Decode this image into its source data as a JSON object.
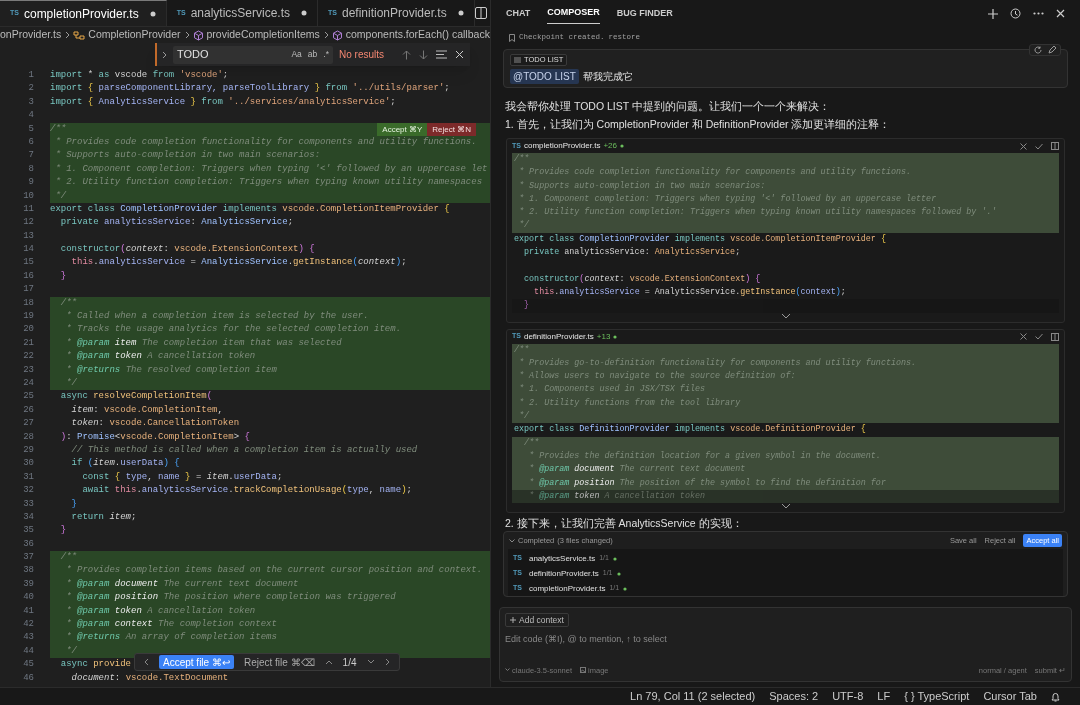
{
  "editor": {
    "tabs": [
      {
        "lang": "TS",
        "label": "completionProvider.ts",
        "selected": true,
        "modified": true
      },
      {
        "lang": "TS",
        "label": "analyticsService.ts",
        "selected": false,
        "modified": true
      },
      {
        "lang": "TS",
        "label": "definitionProvider.ts",
        "selected": false,
        "modified": true
      }
    ],
    "breadcrumbs": [
      {
        "kind": "file",
        "label": "onProvider.ts"
      },
      {
        "kind": "class",
        "label": "CompletionProvider"
      },
      {
        "kind": "method",
        "label": "provideCompletionItems"
      },
      {
        "kind": "method",
        "label": "components.forEach() callback"
      }
    ],
    "find": {
      "value": "TODO",
      "options": [
        "Aa",
        "ab",
        ".*"
      ],
      "result": "No results"
    },
    "lines": [
      {
        "n": "1",
        "diff": false,
        "tokens": [
          {
            "kind": "k",
            "text": "import"
          },
          {
            "kind": "p",
            "text": " * "
          },
          {
            "kind": "k",
            "text": "as"
          },
          {
            "kind": "p",
            "text": " vscode "
          },
          {
            "kind": "k",
            "text": "from"
          },
          {
            "kind": "s",
            "text": " 'vscode'"
          },
          {
            "kind": "p",
            "text": ";"
          }
        ]
      },
      {
        "n": "2",
        "diff": false,
        "tokens": [
          {
            "kind": "k",
            "text": "import"
          },
          {
            "kind": "b1",
            "text": " {"
          },
          {
            "kind": "v",
            "text": " parseComponentLibrary, parseToolLibrary "
          },
          {
            "kind": "b1",
            "text": "}"
          },
          {
            "kind": "k",
            "text": " from"
          },
          {
            "kind": "s",
            "text": " '../utils/parser'"
          },
          {
            "kind": "p",
            "text": ";"
          }
        ]
      },
      {
        "n": "3",
        "diff": false,
        "tokens": [
          {
            "kind": "k",
            "text": "import"
          },
          {
            "kind": "b1",
            "text": " {"
          },
          {
            "kind": "v",
            "text": " AnalyticsService "
          },
          {
            "kind": "b1",
            "text": "}"
          },
          {
            "kind": "k",
            "text": " from"
          },
          {
            "kind": "s",
            "text": " '../services/analyticsService'"
          },
          {
            "kind": "p",
            "text": ";"
          }
        ]
      },
      {
        "n": "4",
        "diff": false
      },
      {
        "n": "5",
        "diff": true,
        "tokens": [
          {
            "kind": "cm",
            "text": "/**"
          }
        ],
        "actions": [
          {
            "kind": "accept",
            "label": "Accept ⌘Y"
          },
          {
            "kind": "reject",
            "label": "Reject ⌘N"
          }
        ]
      },
      {
        "n": "6",
        "diff": true,
        "tokens": [
          {
            "kind": "cm",
            "text": " * Provides code completion functionality for components and utility functions."
          }
        ]
      },
      {
        "n": "7",
        "diff": true,
        "tokens": [
          {
            "kind": "cm",
            "text": " * Supports auto-completion in two main scenarios:"
          }
        ]
      },
      {
        "n": "8",
        "diff": true,
        "tokens": [
          {
            "kind": "cm",
            "text": " * 1. Component completion: Triggers when typing '<' followed by an uppercase let"
          }
        ]
      },
      {
        "n": "9",
        "diff": true,
        "tokens": [
          {
            "kind": "cm",
            "text": " * 2. Utility function completion: Triggers when typing known utility namespaces"
          }
        ]
      },
      {
        "n": "10",
        "diff": true,
        "tokens": [
          {
            "kind": "cm",
            "text": " */"
          }
        ]
      },
      {
        "n": "11",
        "diff": false,
        "tokens": [
          {
            "kind": "k",
            "text": "export class"
          },
          {
            "kind": "c",
            "text": " CompletionProvider"
          },
          {
            "kind": "k",
            "text": " implements"
          },
          {
            "kind": "ty",
            "text": " vscode.CompletionItemProvider"
          },
          {
            "kind": "b1",
            "text": " {"
          }
        ]
      },
      {
        "n": "12",
        "diff": false,
        "tokens": [
          {
            "kind": "k",
            "text": "  private"
          },
          {
            "kind": "v",
            "text": " analyticsService"
          },
          {
            "kind": "p",
            "text": ": "
          },
          {
            "kind": "c",
            "text": "AnalyticsService"
          },
          {
            "kind": "p",
            "text": ";"
          }
        ]
      },
      {
        "n": "13",
        "diff": false
      },
      {
        "n": "14",
        "diff": false,
        "tokens": [
          {
            "kind": "k",
            "text": "  constructor"
          },
          {
            "kind": "b2",
            "text": "("
          },
          {
            "kind": "it",
            "text": "context"
          },
          {
            "kind": "p",
            "text": ": "
          },
          {
            "kind": "ty",
            "text": "vscode.ExtensionContext"
          },
          {
            "kind": "b2",
            "text": ")"
          },
          {
            "kind": "b2",
            "text": " {"
          }
        ]
      },
      {
        "n": "15",
        "diff": false,
        "tokens": [
          {
            "kind": "th",
            "text": "    this"
          },
          {
            "kind": "p",
            "text": "."
          },
          {
            "kind": "v",
            "text": "analyticsService"
          },
          {
            "kind": "p",
            "text": " = "
          },
          {
            "kind": "c",
            "text": "AnalyticsService"
          },
          {
            "kind": "p",
            "text": "."
          },
          {
            "kind": "f",
            "text": "getInstance"
          },
          {
            "kind": "b3",
            "text": "("
          },
          {
            "kind": "it",
            "text": "context"
          },
          {
            "kind": "b3",
            "text": ")"
          },
          {
            "kind": "p",
            "text": ";"
          }
        ]
      },
      {
        "n": "16",
        "diff": false,
        "tokens": [
          {
            "kind": "b2",
            "text": "  }"
          }
        ]
      },
      {
        "n": "17",
        "diff": false
      },
      {
        "n": "18",
        "diff": true,
        "tokens": [
          {
            "kind": "cm",
            "text": "  /**"
          }
        ]
      },
      {
        "n": "19",
        "diff": true,
        "tokens": [
          {
            "kind": "cm",
            "text": "   * Called when a completion item is selected by the user."
          }
        ]
      },
      {
        "n": "20",
        "diff": true,
        "tokens": [
          {
            "kind": "cm",
            "text": "   * Tracks the usage analytics for the selected completion item."
          }
        ]
      },
      {
        "n": "21",
        "diff": true,
        "tokens": [
          {
            "kind": "cm",
            "text": "   * "
          },
          {
            "kind": "tg",
            "text": "@param"
          },
          {
            "kind": "pa",
            "text": " item"
          },
          {
            "kind": "cm",
            "text": " The completion item that was selected"
          }
        ]
      },
      {
        "n": "22",
        "diff": true,
        "tokens": [
          {
            "kind": "cm",
            "text": "   * "
          },
          {
            "kind": "tg",
            "text": "@param"
          },
          {
            "kind": "pa",
            "text": " token"
          },
          {
            "kind": "cm",
            "text": " A cancellation token"
          }
        ]
      },
      {
        "n": "23",
        "diff": true,
        "tokens": [
          {
            "kind": "cm",
            "text": "   * "
          },
          {
            "kind": "tg",
            "text": "@returns"
          },
          {
            "kind": "cm",
            "text": " The resolved completion item"
          }
        ]
      },
      {
        "n": "24",
        "diff": true,
        "tokens": [
          {
            "kind": "cm",
            "text": "   */"
          }
        ]
      },
      {
        "n": "25",
        "diff": false,
        "tokens": [
          {
            "kind": "k",
            "text": "  async"
          },
          {
            "kind": "f",
            "text": " resolveCompletionItem"
          },
          {
            "kind": "b2",
            "text": "("
          }
        ]
      },
      {
        "n": "26",
        "diff": false,
        "tokens": [
          {
            "kind": "it",
            "text": "    item"
          },
          {
            "kind": "p",
            "text": ": "
          },
          {
            "kind": "ty",
            "text": "vscode.CompletionItem"
          },
          {
            "kind": "p",
            "text": ","
          }
        ]
      },
      {
        "n": "27",
        "diff": false,
        "tokens": [
          {
            "kind": "it",
            "text": "    token"
          },
          {
            "kind": "p",
            "text": ": "
          },
          {
            "kind": "ty",
            "text": "vscode.CancellationToken"
          }
        ]
      },
      {
        "n": "28",
        "diff": false,
        "tokens": [
          {
            "kind": "b2",
            "text": "  )"
          },
          {
            "kind": "p",
            "text": ": "
          },
          {
            "kind": "c",
            "text": "Promise"
          },
          {
            "kind": "p",
            "text": "<"
          },
          {
            "kind": "ty",
            "text": "vscode.CompletionItem"
          },
          {
            "kind": "p",
            "text": ">"
          },
          {
            "kind": "b2",
            "text": " {"
          }
        ]
      },
      {
        "n": "29",
        "diff": false,
        "tokens": [
          {
            "kind": "cm",
            "text": "    // This method is called when a completion item is actually used"
          }
        ]
      },
      {
        "n": "30",
        "diff": false,
        "tokens": [
          {
            "kind": "k",
            "text": "    if"
          },
          {
            "kind": "b3",
            "text": " ("
          },
          {
            "kind": "it",
            "text": "item"
          },
          {
            "kind": "p",
            "text": "."
          },
          {
            "kind": "v",
            "text": "userData"
          },
          {
            "kind": "b3",
            "text": ")"
          },
          {
            "kind": "b3",
            "text": " {"
          }
        ]
      },
      {
        "n": "31",
        "diff": false,
        "tokens": [
          {
            "kind": "k",
            "text": "      const"
          },
          {
            "kind": "b1",
            "text": " {"
          },
          {
            "kind": "v",
            "text": " type"
          },
          {
            "kind": "p",
            "text": ", "
          },
          {
            "kind": "v",
            "text": "name "
          },
          {
            "kind": "b1",
            "text": "}"
          },
          {
            "kind": "p",
            "text": " = "
          },
          {
            "kind": "it",
            "text": "item"
          },
          {
            "kind": "p",
            "text": "."
          },
          {
            "kind": "v",
            "text": "userData"
          },
          {
            "kind": "p",
            "text": ";"
          }
        ]
      },
      {
        "n": "32",
        "diff": false,
        "tokens": [
          {
            "kind": "k",
            "text": "      await"
          },
          {
            "kind": "th",
            "text": " this"
          },
          {
            "kind": "p",
            "text": "."
          },
          {
            "kind": "v",
            "text": "analyticsService"
          },
          {
            "kind": "p",
            "text": "."
          },
          {
            "kind": "f",
            "text": "trackCompletionUsage"
          },
          {
            "kind": "b1",
            "text": "("
          },
          {
            "kind": "v",
            "text": "type"
          },
          {
            "kind": "p",
            "text": ", "
          },
          {
            "kind": "v",
            "text": "name"
          },
          {
            "kind": "b1",
            "text": ")"
          },
          {
            "kind": "p",
            "text": ";"
          }
        ]
      },
      {
        "n": "33",
        "diff": false,
        "tokens": [
          {
            "kind": "b3",
            "text": "    }"
          }
        ]
      },
      {
        "n": "34",
        "diff": false,
        "tokens": [
          {
            "kind": "k",
            "text": "    return"
          },
          {
            "kind": "it",
            "text": " item"
          },
          {
            "kind": "p",
            "text": ";"
          }
        ]
      },
      {
        "n": "35",
        "diff": false,
        "tokens": [
          {
            "kind": "b2",
            "text": "  }"
          }
        ]
      },
      {
        "n": "36",
        "diff": false
      },
      {
        "n": "37",
        "diff": true,
        "tokens": [
          {
            "kind": "cm",
            "text": "  /**"
          }
        ]
      },
      {
        "n": "38",
        "diff": true,
        "tokens": [
          {
            "kind": "cm",
            "text": "   * Provides completion items based on the current cursor position and context."
          }
        ]
      },
      {
        "n": "39",
        "diff": true,
        "tokens": [
          {
            "kind": "cm",
            "text": "   * "
          },
          {
            "kind": "tg",
            "text": "@param"
          },
          {
            "kind": "pa",
            "text": " document"
          },
          {
            "kind": "cm",
            "text": " The current text document"
          }
        ]
      },
      {
        "n": "40",
        "diff": true,
        "tokens": [
          {
            "kind": "cm",
            "text": "   * "
          },
          {
            "kind": "tg",
            "text": "@param"
          },
          {
            "kind": "pa",
            "text": " position"
          },
          {
            "kind": "cm",
            "text": " The position where completion was triggered"
          }
        ]
      },
      {
        "n": "41",
        "diff": true,
        "tokens": [
          {
            "kind": "cm",
            "text": "   * "
          },
          {
            "kind": "tg",
            "text": "@param"
          },
          {
            "kind": "pa",
            "text": " token"
          },
          {
            "kind": "cm",
            "text": " A cancellation token"
          }
        ]
      },
      {
        "n": "42",
        "diff": true,
        "tokens": [
          {
            "kind": "cm",
            "text": "   * "
          },
          {
            "kind": "tg",
            "text": "@param"
          },
          {
            "kind": "pa",
            "text": " context"
          },
          {
            "kind": "cm",
            "text": " The completion context"
          }
        ]
      },
      {
        "n": "43",
        "diff": true,
        "tokens": [
          {
            "kind": "cm",
            "text": "   * "
          },
          {
            "kind": "tg",
            "text": "@returns"
          },
          {
            "kind": "cm",
            "text": " An array of completion items"
          }
        ]
      },
      {
        "n": "44",
        "diff": true,
        "tokens": [
          {
            "kind": "cm",
            "text": "   */"
          }
        ]
      },
      {
        "n": "45",
        "diff": false,
        "tokens": [
          {
            "kind": "k",
            "text": "  async"
          },
          {
            "kind": "f",
            "text": " provide"
          }
        ]
      },
      {
        "n": "46",
        "diff": false,
        "tokens": [
          {
            "kind": "it",
            "text": "    document"
          },
          {
            "kind": "p",
            "text": ": "
          },
          {
            "kind": "ty",
            "text": "vscode.TextDocument"
          }
        ]
      }
    ],
    "review_bar": {
      "accept": "Accept file ⌘↩",
      "reject": "Reject file ⌘⌫",
      "position": "1/4"
    }
  },
  "panel": {
    "tabs": [
      {
        "label": "CHAT",
        "selected": false
      },
      {
        "label": "COMPOSER",
        "selected": true
      },
      {
        "label": "BUG FINDER",
        "selected": false
      }
    ],
    "checkpoint": {
      "text": "Checkpoint created.",
      "link": "restore"
    },
    "user_message": {
      "chip": "TODO LIST",
      "mention": "@TODO LIST",
      "text": "帮我完成它"
    },
    "messages": [
      {
        "kind": "text",
        "text": "我会帮你处理 TODO LIST 中提到的问题。让我们一个一个来解决："
      },
      {
        "kind": "text",
        "text": "1. 首先，让我们为 CompletionProvider 和 DefinitionProvider 添加更详细的注释："
      },
      {
        "kind": "code",
        "lang": "TS",
        "file": "completionProvider.ts",
        "added": "+26",
        "lines": [
          {
            "diff": true,
            "faded": false,
            "tokens": [
              {
                "kind": "cm",
                "text": "/**"
              }
            ]
          },
          {
            "diff": true,
            "faded": false,
            "tokens": [
              {
                "kind": "cm",
                "text": " * Provides code completion functionality for components and utility functions."
              }
            ]
          },
          {
            "diff": true,
            "faded": false,
            "tokens": [
              {
                "kind": "cm",
                "text": " * Supports auto-completion in two main scenarios:"
              }
            ]
          },
          {
            "diff": true,
            "faded": false,
            "tokens": [
              {
                "kind": "cm",
                "text": " * 1. Component completion: Triggers when typing '<' followed by an uppercase letter"
              }
            ]
          },
          {
            "diff": true,
            "faded": false,
            "tokens": [
              {
                "kind": "cm",
                "text": " * 2. Utility function completion: Triggers when typing known utility namespaces followed by '.'"
              }
            ]
          },
          {
            "diff": true,
            "faded": false,
            "tokens": [
              {
                "kind": "cm",
                "text": " */"
              }
            ]
          },
          {
            "diff": false,
            "faded": false,
            "tokens": [
              {
                "kind": "k",
                "text": "export class"
              },
              {
                "kind": "c",
                "text": " CompletionProvider"
              },
              {
                "kind": "k",
                "text": " implements"
              },
              {
                "kind": "ty",
                "text": " vscode.CompletionItemProvider"
              },
              {
                "kind": "b1",
                "text": " {"
              }
            ]
          },
          {
            "diff": false,
            "faded": false,
            "tokens": [
              {
                "kind": "k",
                "text": "  private"
              },
              {
                "kind": "p",
                "text": " analyticsService: "
              },
              {
                "kind": "ty",
                "text": "AnalyticsService"
              },
              {
                "kind": "p",
                "text": ";"
              }
            ]
          },
          {
            "diff": false
          },
          {
            "diff": false,
            "faded": false,
            "tokens": [
              {
                "kind": "k",
                "text": "  constructor"
              },
              {
                "kind": "b2",
                "text": "("
              },
              {
                "kind": "it",
                "text": "context"
              },
              {
                "kind": "p",
                "text": ": "
              },
              {
                "kind": "ty",
                "text": "vscode.ExtensionContext"
              },
              {
                "kind": "b2",
                "text": ")"
              },
              {
                "kind": "b2",
                "text": " {"
              }
            ]
          },
          {
            "diff": false,
            "faded": false,
            "tokens": [
              {
                "kind": "th",
                "text": "    this"
              },
              {
                "kind": "p",
                "text": "."
              },
              {
                "kind": "v",
                "text": "analyticsService"
              },
              {
                "kind": "p",
                "text": " = AnalyticsService."
              },
              {
                "kind": "f",
                "text": "getInstance"
              },
              {
                "kind": "b3",
                "text": "("
              },
              {
                "kind": "v",
                "text": "context"
              },
              {
                "kind": "b3",
                "text": ")"
              },
              {
                "kind": "p",
                "text": ";"
              }
            ]
          },
          {
            "diff": false,
            "faded": true,
            "tokens": [
              {
                "kind": "b2",
                "text": "  }"
              }
            ]
          }
        ]
      },
      {
        "kind": "code",
        "lang": "TS",
        "file": "definitionProvider.ts",
        "added": "+13",
        "lines": [
          {
            "diff": true,
            "faded": false,
            "tokens": [
              {
                "kind": "cm",
                "text": "/**"
              }
            ]
          },
          {
            "diff": true,
            "faded": false,
            "tokens": [
              {
                "kind": "cm",
                "text": " * Provides go-to-definition functionality for components and utility functions."
              }
            ]
          },
          {
            "diff": true,
            "faded": false,
            "tokens": [
              {
                "kind": "cm",
                "text": " * Allows users to navigate to the source definition of:"
              }
            ]
          },
          {
            "diff": true,
            "faded": false,
            "tokens": [
              {
                "kind": "cm",
                "text": " * 1. Components used in JSX/TSX files"
              }
            ]
          },
          {
            "diff": true,
            "faded": false,
            "tokens": [
              {
                "kind": "cm",
                "text": " * 2. Utility functions from the tool library"
              }
            ]
          },
          {
            "diff": true,
            "faded": false,
            "tokens": [
              {
                "kind": "cm",
                "text": " */"
              }
            ]
          },
          {
            "diff": false,
            "faded": false,
            "tokens": [
              {
                "kind": "k",
                "text": "export class"
              },
              {
                "kind": "c",
                "text": " DefinitionProvider"
              },
              {
                "kind": "k",
                "text": " implements"
              },
              {
                "kind": "ty",
                "text": " vscode.DefinitionProvider"
              },
              {
                "kind": "b1",
                "text": " {"
              }
            ]
          },
          {
            "diff": true,
            "faded": false,
            "tokens": [
              {
                "kind": "cm",
                "text": "  /**"
              }
            ]
          },
          {
            "diff": true,
            "faded": false,
            "tokens": [
              {
                "kind": "cm",
                "text": "   * Provides the definition location for a given symbol in the document."
              }
            ]
          },
          {
            "diff": true,
            "faded": false,
            "tokens": [
              {
                "kind": "cm",
                "text": "   * "
              },
              {
                "kind": "tg",
                "text": "@param"
              },
              {
                "kind": "pa",
                "text": " document"
              },
              {
                "kind": "cm",
                "text": " The current text document"
              }
            ]
          },
          {
            "diff": true,
            "faded": false,
            "tokens": [
              {
                "kind": "cm",
                "text": "   * "
              },
              {
                "kind": "tg",
                "text": "@param"
              },
              {
                "kind": "pa",
                "text": " position"
              },
              {
                "kind": "cm",
                "text": " The position of the symbol to find the definition for"
              }
            ]
          },
          {
            "diff": true,
            "faded": true,
            "tokens": [
              {
                "kind": "cm",
                "text": "   * "
              },
              {
                "kind": "tg",
                "text": "@param"
              },
              {
                "kind": "pa",
                "text": " token"
              },
              {
                "kind": "cm",
                "text": " A cancellation token"
              }
            ]
          }
        ]
      },
      {
        "kind": "text",
        "text": "2. 接下来，让我们完善 AnalyticsService 的实现："
      },
      {
        "kind": "changes",
        "title": "Completed",
        "subtitle": "(3 files changed)",
        "buttons": [
          {
            "label": "Save all",
            "primary": false
          },
          {
            "label": "Reject all",
            "primary": false
          },
          {
            "label": "Accept all",
            "primary": true
          }
        ],
        "files": [
          {
            "lang": "TS",
            "name": "analyticsService.ts",
            "count": "1/1"
          },
          {
            "lang": "TS",
            "name": "definitionProvider.ts",
            "count": "1/1"
          },
          {
            "lang": "TS",
            "name": "completionProvider.ts",
            "count": "1/1"
          }
        ]
      }
    ],
    "composer": {
      "add_context": "Add context",
      "placeholder": "Edit code (⌘I), @ to mention, ↑ to select",
      "model": "claude-3.5-sonnet",
      "image": "image",
      "mode": "normal / agent",
      "submit": "submit ↵"
    }
  },
  "status_bar": [
    "Ln 79, Col 11 (2 selected)",
    "Spaces: 2",
    "UTF-8",
    "LF",
    "{ } TypeScript",
    "Cursor Tab"
  ]
}
